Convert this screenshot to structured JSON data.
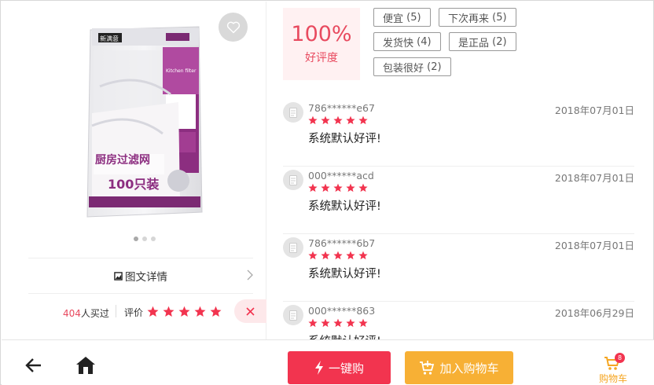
{
  "product": {
    "package_brand": "新满意",
    "package_title": "厨房过滤网",
    "package_count": "100只装",
    "package_subtitle": "Kitchen filter",
    "carousel": {
      "total": 3,
      "active": 0
    },
    "detail_link_label": "图文详情",
    "buyers_count": "404",
    "buyers_suffix": "人买过",
    "rating_label": "评价",
    "rating_stars": 5
  },
  "summary": {
    "percent": "100%",
    "label": "好评度"
  },
  "tags": [
    {
      "label": "便宜",
      "count": "(5)"
    },
    {
      "label": "下次再来",
      "count": "(5)"
    },
    {
      "label": "发货快",
      "count": "(4)"
    },
    {
      "label": "是正品",
      "count": "(2)"
    },
    {
      "label": "包装很好",
      "count": "(2)"
    }
  ],
  "reviews": [
    {
      "user": "786******e67",
      "date": "2018年07月01日",
      "stars": 5,
      "text": "系统默认好评!"
    },
    {
      "user": "000******acd",
      "date": "2018年07月01日",
      "stars": 5,
      "text": "系统默认好评!"
    },
    {
      "user": "786******6b7",
      "date": "2018年07月01日",
      "stars": 5,
      "text": "系统默认好评!"
    },
    {
      "user": "000******863",
      "date": "2018年06月29日",
      "stars": 5,
      "text": "系统默认好评!"
    }
  ],
  "bottom_bar": {
    "buy_now_label": "一键购",
    "add_to_cart_label": "加入购物车",
    "cart_label": "购物车",
    "cart_badge": "8"
  },
  "colors": {
    "accent_red": "#f2344f",
    "accent_orange": "#f7b035",
    "star_red": "#f2344f",
    "score_bg": "#fff1f2"
  },
  "icons": [
    "heart-icon",
    "image-icon",
    "chevron-right-icon",
    "close-icon",
    "avatar-icon",
    "star-icon",
    "back-arrow-icon",
    "home-icon",
    "lightning-icon",
    "cart-add-icon",
    "cart-icon"
  ]
}
